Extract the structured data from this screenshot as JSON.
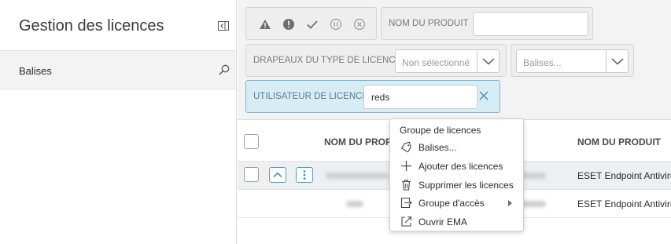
{
  "sidebar": {
    "title": "Gestion des licences",
    "collapse_icon": "collapse-panel-icon",
    "tags_label": "Balises",
    "tags_search_icon": "search-icon"
  },
  "filters": {
    "status_icons": [
      "warning-icon",
      "error-icon",
      "check-icon",
      "pause-icon",
      "cancel-icon"
    ],
    "product_label": "NOM DU PRODUIT",
    "product_value": "",
    "flags_label": "DRAPEAUX DU TYPE DE LICENCE",
    "flags_value": "Non sélectionné",
    "tags_placeholder": "Balises...",
    "user_label": "UTILISATEUR DE LICENCE",
    "user_value": "reds",
    "accent_color": "#74b7d6"
  },
  "table": {
    "columns": [
      "NOM DU PROP",
      "NOM DU PRODUIT"
    ],
    "rows": [
      {
        "product": "ESET Endpoint Antiviru"
      },
      {
        "product": "ESET Endpoint Antiviru"
      }
    ]
  },
  "context_menu": {
    "title": "Groupe de licences",
    "items": [
      {
        "label": "Balises...",
        "icon": "tag-icon"
      },
      {
        "label": "Ajouter des licences",
        "icon": "plus-icon"
      },
      {
        "label": "Supprimer les licences",
        "icon": "trash-icon"
      },
      {
        "label": "Groupe d'accès",
        "icon": "move-group-icon"
      },
      {
        "label": "Ouvrir EMA",
        "icon": "external-link-icon"
      }
    ]
  }
}
